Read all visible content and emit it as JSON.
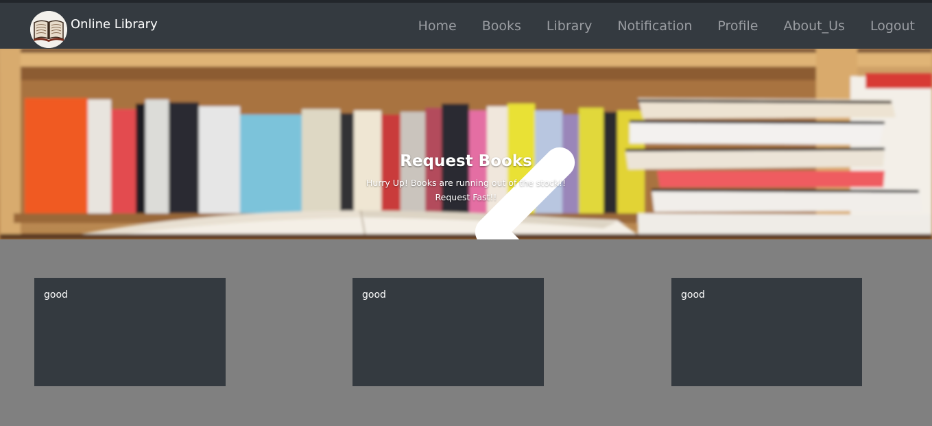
{
  "navbar": {
    "brand": "Online Library",
    "logo_icon": "open-book-icon",
    "links": [
      {
        "label": "Home"
      },
      {
        "label": "Books"
      },
      {
        "label": "Library"
      },
      {
        "label": "Notification"
      },
      {
        "label": "Profile"
      },
      {
        "label": "About_Us"
      },
      {
        "label": "Logout"
      }
    ]
  },
  "carousel": {
    "title": "Request Books",
    "text": "Hurry Up! Books are running out of the stock!! Request Fast!!",
    "prev_icon": "chevron-left-icon"
  },
  "cards": [
    {
      "text": "good"
    },
    {
      "text": "good"
    },
    {
      "text": "good"
    }
  ],
  "colors": {
    "navbar_bg": "#343a40",
    "page_bg": "#808080",
    "card_bg": "#343a40",
    "nav_link": "#9a9da2"
  }
}
